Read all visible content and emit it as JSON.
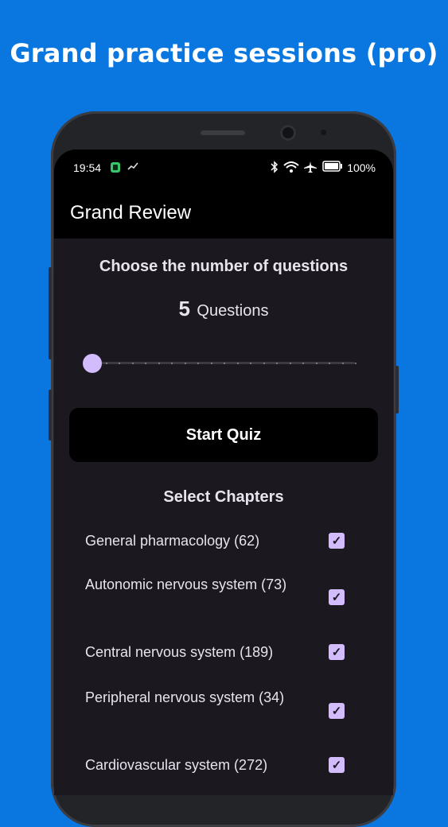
{
  "headline": "Grand practice sessions (pro)",
  "status_bar": {
    "time": "19:54",
    "battery": "100%",
    "icons": [
      "battery-saver-icon",
      "trending-icon",
      "bluetooth-icon",
      "wifi-icon",
      "airplane-icon",
      "battery-icon"
    ]
  },
  "app_bar": {
    "title": "Grand Review"
  },
  "question_count": {
    "label": "Choose the number of questions",
    "value": "5",
    "unit": "Questions",
    "slider_fraction": 0
  },
  "start_button": {
    "label": "Start Quiz"
  },
  "chapters": {
    "title": "Select Chapters",
    "items": [
      {
        "label": "General pharmacology (62)",
        "checked": true
      },
      {
        "label": "Autonomic nervous system (73)",
        "checked": true
      },
      {
        "label": "Central nervous system (189)",
        "checked": true
      },
      {
        "label": "Peripheral nervous system (34)",
        "checked": true
      },
      {
        "label": "Cardiovascular system (272)",
        "checked": true
      }
    ]
  },
  "colors": {
    "background": "#0a77e1",
    "accent": "#d3bcfc",
    "surface": "#1b181f"
  }
}
